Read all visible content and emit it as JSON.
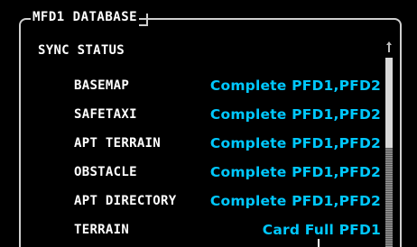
{
  "window": {
    "title": "MFD1 DATABASE"
  },
  "section": {
    "title": "SYNC STATUS"
  },
  "rows": [
    {
      "label": "BASEMAP",
      "value": "Complete PFD1,PFD2"
    },
    {
      "label": "SAFETAXI",
      "value": "Complete PFD1,PFD2"
    },
    {
      "label": "APT TERRAIN",
      "value": "Complete PFD1,PFD2"
    },
    {
      "label": "OBSTACLE",
      "value": "Complete PFD1,PFD2"
    },
    {
      "label": "APT DIRECTORY",
      "value": "Complete PFD1,PFD2"
    },
    {
      "label": "TERRAIN",
      "value": "Card Full PFD1"
    }
  ],
  "colors": {
    "label": "#ffffff",
    "value": "#00c8ff",
    "background": "#000000",
    "border": "#cfcfcf"
  }
}
